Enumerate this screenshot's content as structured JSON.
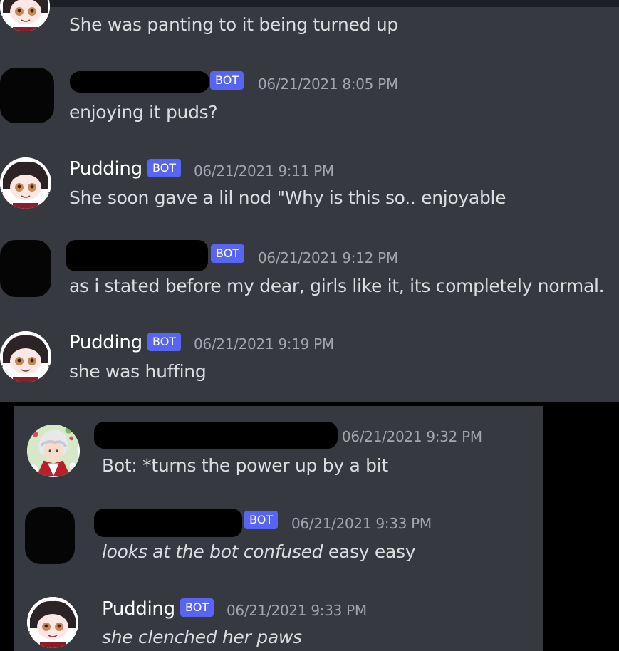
{
  "messages": [
    {
      "author": "",
      "bot": "",
      "timestamp": "",
      "text": "She was panting to it being turned up"
    },
    {
      "author": "",
      "bot": "BOT",
      "timestamp": "06/21/2021 8:05 PM",
      "text": "enjoying it puds?"
    },
    {
      "author": "Pudding",
      "bot": "BOT",
      "timestamp": "06/21/2021 9:11 PM",
      "text": "She soon gave a lil nod \"Why is this so.. enjoyable"
    },
    {
      "author": "",
      "bot": "BOT",
      "timestamp": "06/21/2021 9:12 PM",
      "text": "as i stated before my dear, girls like it, its completely normal."
    },
    {
      "author": "Pudding",
      "bot": "BOT",
      "timestamp": "06/21/2021 9:19 PM",
      "text": "she was huffing"
    },
    {
      "author": "",
      "bot": "",
      "timestamp": "06/21/2021 9:32 PM",
      "text": "Bot: *turns the power up by a bit"
    },
    {
      "author": "",
      "bot": "BOT",
      "timestamp": "06/21/2021 9:33 PM",
      "text_italic": "looks at the bot confused",
      "text": " easy easy"
    },
    {
      "author": "Pudding",
      "bot": "BOT",
      "timestamp": "06/21/2021 9:33 PM",
      "text": "she clenched her paws"
    }
  ],
  "colors": {
    "background": "#36393f",
    "outer": "#000000",
    "bot_badge": "#5865f2",
    "username": "#ffffff",
    "timestamp": "#a3a6aa",
    "text": "#dcddde"
  },
  "icons": {
    "pudding_avatar": "pudding-avatar-icon",
    "user_avatar": "anime-character-avatar-icon"
  }
}
